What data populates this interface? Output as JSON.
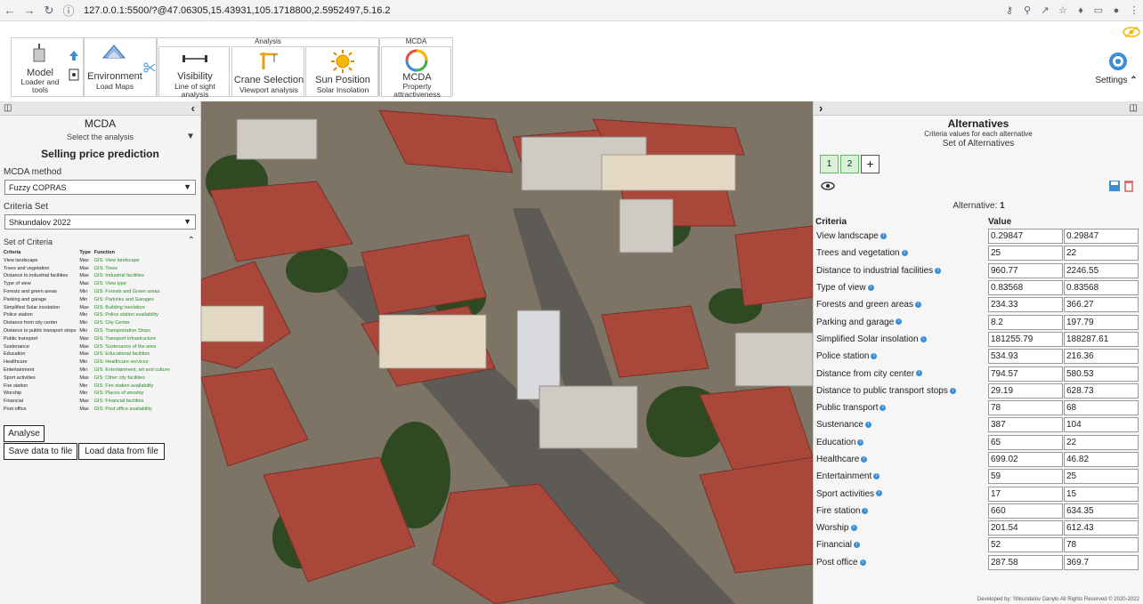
{
  "browser": {
    "url": "127.0.0.1:5500/?@47.06305,15.43931,105.1718800,2.5952497,5.16.2"
  },
  "toolbar": {
    "model_label": "Model",
    "model_sub": "Loader and tools",
    "environment_label": "Environment",
    "environment_sub": "Load Maps",
    "analysis_group": "Analysis",
    "visibility_label": "Visibility",
    "visibility_sub": "Line of sight analysis",
    "crane_label": "Crane Selection",
    "crane_sub": "Viewport analysis",
    "sun_label": "Sun Position",
    "sun_sub": "Solar Insolation",
    "mcda_group": "MCDA",
    "mcda_label": "MCDA",
    "mcda_sub": "Property attractiveness",
    "settings_label": "Settings"
  },
  "left_panel": {
    "title": "MCDA",
    "select_analysis": "Select the analysis",
    "prediction_title": "Selling price prediction",
    "method_label": "MCDA method",
    "method_value": "Fuzzy COPRAS",
    "criteria_set_label": "Criteria Set",
    "criteria_set_value": "Shkundalov 2022",
    "set_of_criteria_label": "Set of Criteria",
    "columns": [
      "Criteria",
      "Type",
      "Function"
    ],
    "criteria": [
      [
        "View landscape",
        "Max",
        "GIS: View landscape"
      ],
      [
        "Trees and vegetation",
        "Max",
        "GIS: Trees"
      ],
      [
        "Distance to industrial facilities",
        "Max",
        "GIS: Industrial facilities"
      ],
      [
        "Type of view",
        "Max",
        "GIS: View type"
      ],
      [
        "Forests and green areas",
        "Min",
        "GIS: Forests and Green areas"
      ],
      [
        "Parking and garage",
        "Min",
        "GIS: Parkinks and Garages"
      ],
      [
        "Simplified Solar insolation",
        "Max",
        "GIS: Building insolation"
      ],
      [
        "Police station",
        "Min",
        "GIS: Police station availability"
      ],
      [
        "Distance from city center",
        "Min",
        "GIS: City Center"
      ],
      [
        "Distance to public transport stops",
        "Min",
        "GIS: Transportation Stops"
      ],
      [
        "Public transport",
        "Max",
        "GIS: Transport infrastructure"
      ],
      [
        "Sustenance",
        "Max",
        "GIS: Sustenance of the area"
      ],
      [
        "Education",
        "Max",
        "GIS: Educational facilities"
      ],
      [
        "Healthcare",
        "Min",
        "GIS: Healthcare services"
      ],
      [
        "Entertainment",
        "Min",
        "GIS: Entertainment, art and culture"
      ],
      [
        "Sport activities",
        "Max",
        "GIS: Other city facilities"
      ],
      [
        "Fire station",
        "Min",
        "GIS: Fire station availability"
      ],
      [
        "Worship",
        "Min",
        "GIS: Places of worship"
      ],
      [
        "Financial",
        "Max",
        "GIS: Financial facilities"
      ],
      [
        "Post office",
        "Max",
        "GIS: Post office availability"
      ]
    ],
    "analyse_btn": "Analyse",
    "save_btn": "Save data to file",
    "load_btn": "Load data from file"
  },
  "right_panel": {
    "title": "Alternatives",
    "subtitle": "Criteria values for each alternative",
    "set_label": "Set of Alternatives",
    "tab1": "1",
    "tab2": "2",
    "add_tab": "+",
    "alternative_label": "Alternative:",
    "alternative_number": "1",
    "col_criteria": "Criteria",
    "col_value": "Value",
    "rows": [
      {
        "name": "View landscape",
        "v1": "0.29847",
        "v2": "0.29847"
      },
      {
        "name": "Trees and vegetation",
        "v1": "25",
        "v2": "22"
      },
      {
        "name": "Distance to industrial facilities",
        "v1": "960.77",
        "v2": "2246.55"
      },
      {
        "name": "Type of view",
        "v1": "0.83568",
        "v2": "0.83568"
      },
      {
        "name": "Forests and green areas",
        "v1": "234.33",
        "v2": "366.27"
      },
      {
        "name": "Parking and garage",
        "v1": "8.2",
        "v2": "197.79"
      },
      {
        "name": "Simplified Solar insolation",
        "v1": "181255.79",
        "v2": "188287.61"
      },
      {
        "name": "Police station",
        "v1": "534.93",
        "v2": "216.36"
      },
      {
        "name": "Distance from city center",
        "v1": "794.57",
        "v2": "580.53"
      },
      {
        "name": "Distance to public transport stops",
        "v1": "29.19",
        "v2": "628.73"
      },
      {
        "name": "Public transport",
        "v1": "78",
        "v2": "68"
      },
      {
        "name": "Sustenance",
        "v1": "387",
        "v2": "104"
      },
      {
        "name": "Education",
        "v1": "65",
        "v2": "22"
      },
      {
        "name": "Healthcare",
        "v1": "699.02",
        "v2": "46.82"
      },
      {
        "name": "Entertainment",
        "v1": "59",
        "v2": "25"
      },
      {
        "name": "Sport activities",
        "v1": "17",
        "v2": "15"
      },
      {
        "name": "Fire station",
        "v1": "660",
        "v2": "634.35"
      },
      {
        "name": "Worship",
        "v1": "201.54",
        "v2": "612.43"
      },
      {
        "name": "Financial",
        "v1": "52",
        "v2": "78"
      },
      {
        "name": "Post office",
        "v1": "287.58",
        "v2": "369.7"
      }
    ],
    "footer": "Developed by: Shkundalov Danylo    All Rights Reserved © 2020-2022"
  },
  "colors": {
    "accent_green": "#5cb85c",
    "info_blue": "#3c8fd6",
    "function_green": "#2a8a2a"
  }
}
